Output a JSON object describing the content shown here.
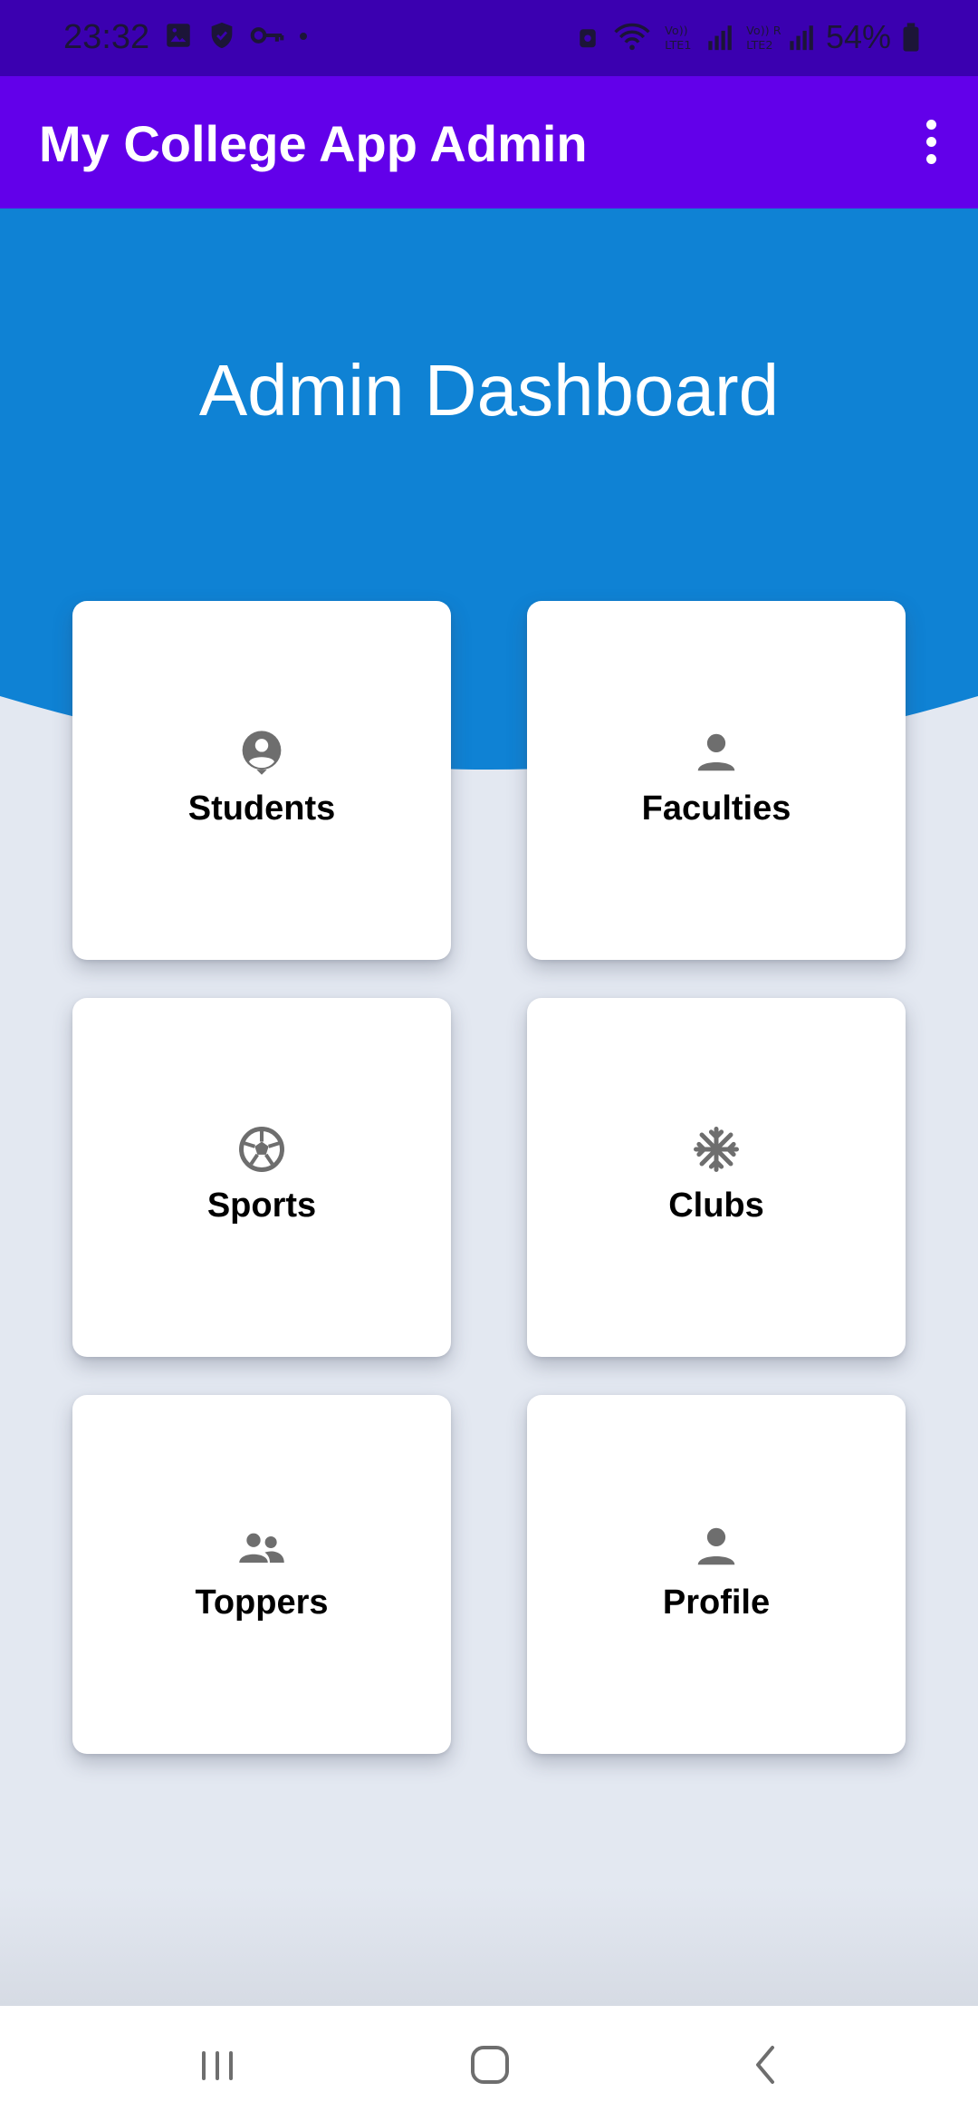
{
  "status_bar": {
    "time": "23:32",
    "battery": "54%",
    "left_icons": [
      "image-icon",
      "shield-icon",
      "key-icon",
      "dot-icon"
    ],
    "right_icons": [
      "alarm-icon",
      "wifi-icon",
      "lte1-signal-icon",
      "lte2-signal-icon",
      "battery-icon"
    ],
    "background": "#3b00b0"
  },
  "app_bar": {
    "title": "My College App Admin",
    "background": "#6200ea",
    "menu_icon": "more-vert-icon"
  },
  "header": {
    "title": "Admin Dashboard",
    "background": "#0f82d4"
  },
  "cards": [
    {
      "label": "Students",
      "icon": "account-circle-icon"
    },
    {
      "label": "Faculties",
      "icon": "person-icon"
    },
    {
      "label": "Sports",
      "icon": "soccer-ball-icon"
    },
    {
      "label": "Clubs",
      "icon": "snowflake-icon"
    },
    {
      "label": "Toppers",
      "icon": "people-icon"
    },
    {
      "label": "Profile",
      "icon": "person-icon"
    }
  ],
  "nav_bar": {
    "buttons": [
      "recent-apps-icon",
      "home-icon",
      "back-icon"
    ]
  },
  "colors": {
    "page_background": "#e3e8f1",
    "icon_gray": "#6e6e6e"
  }
}
